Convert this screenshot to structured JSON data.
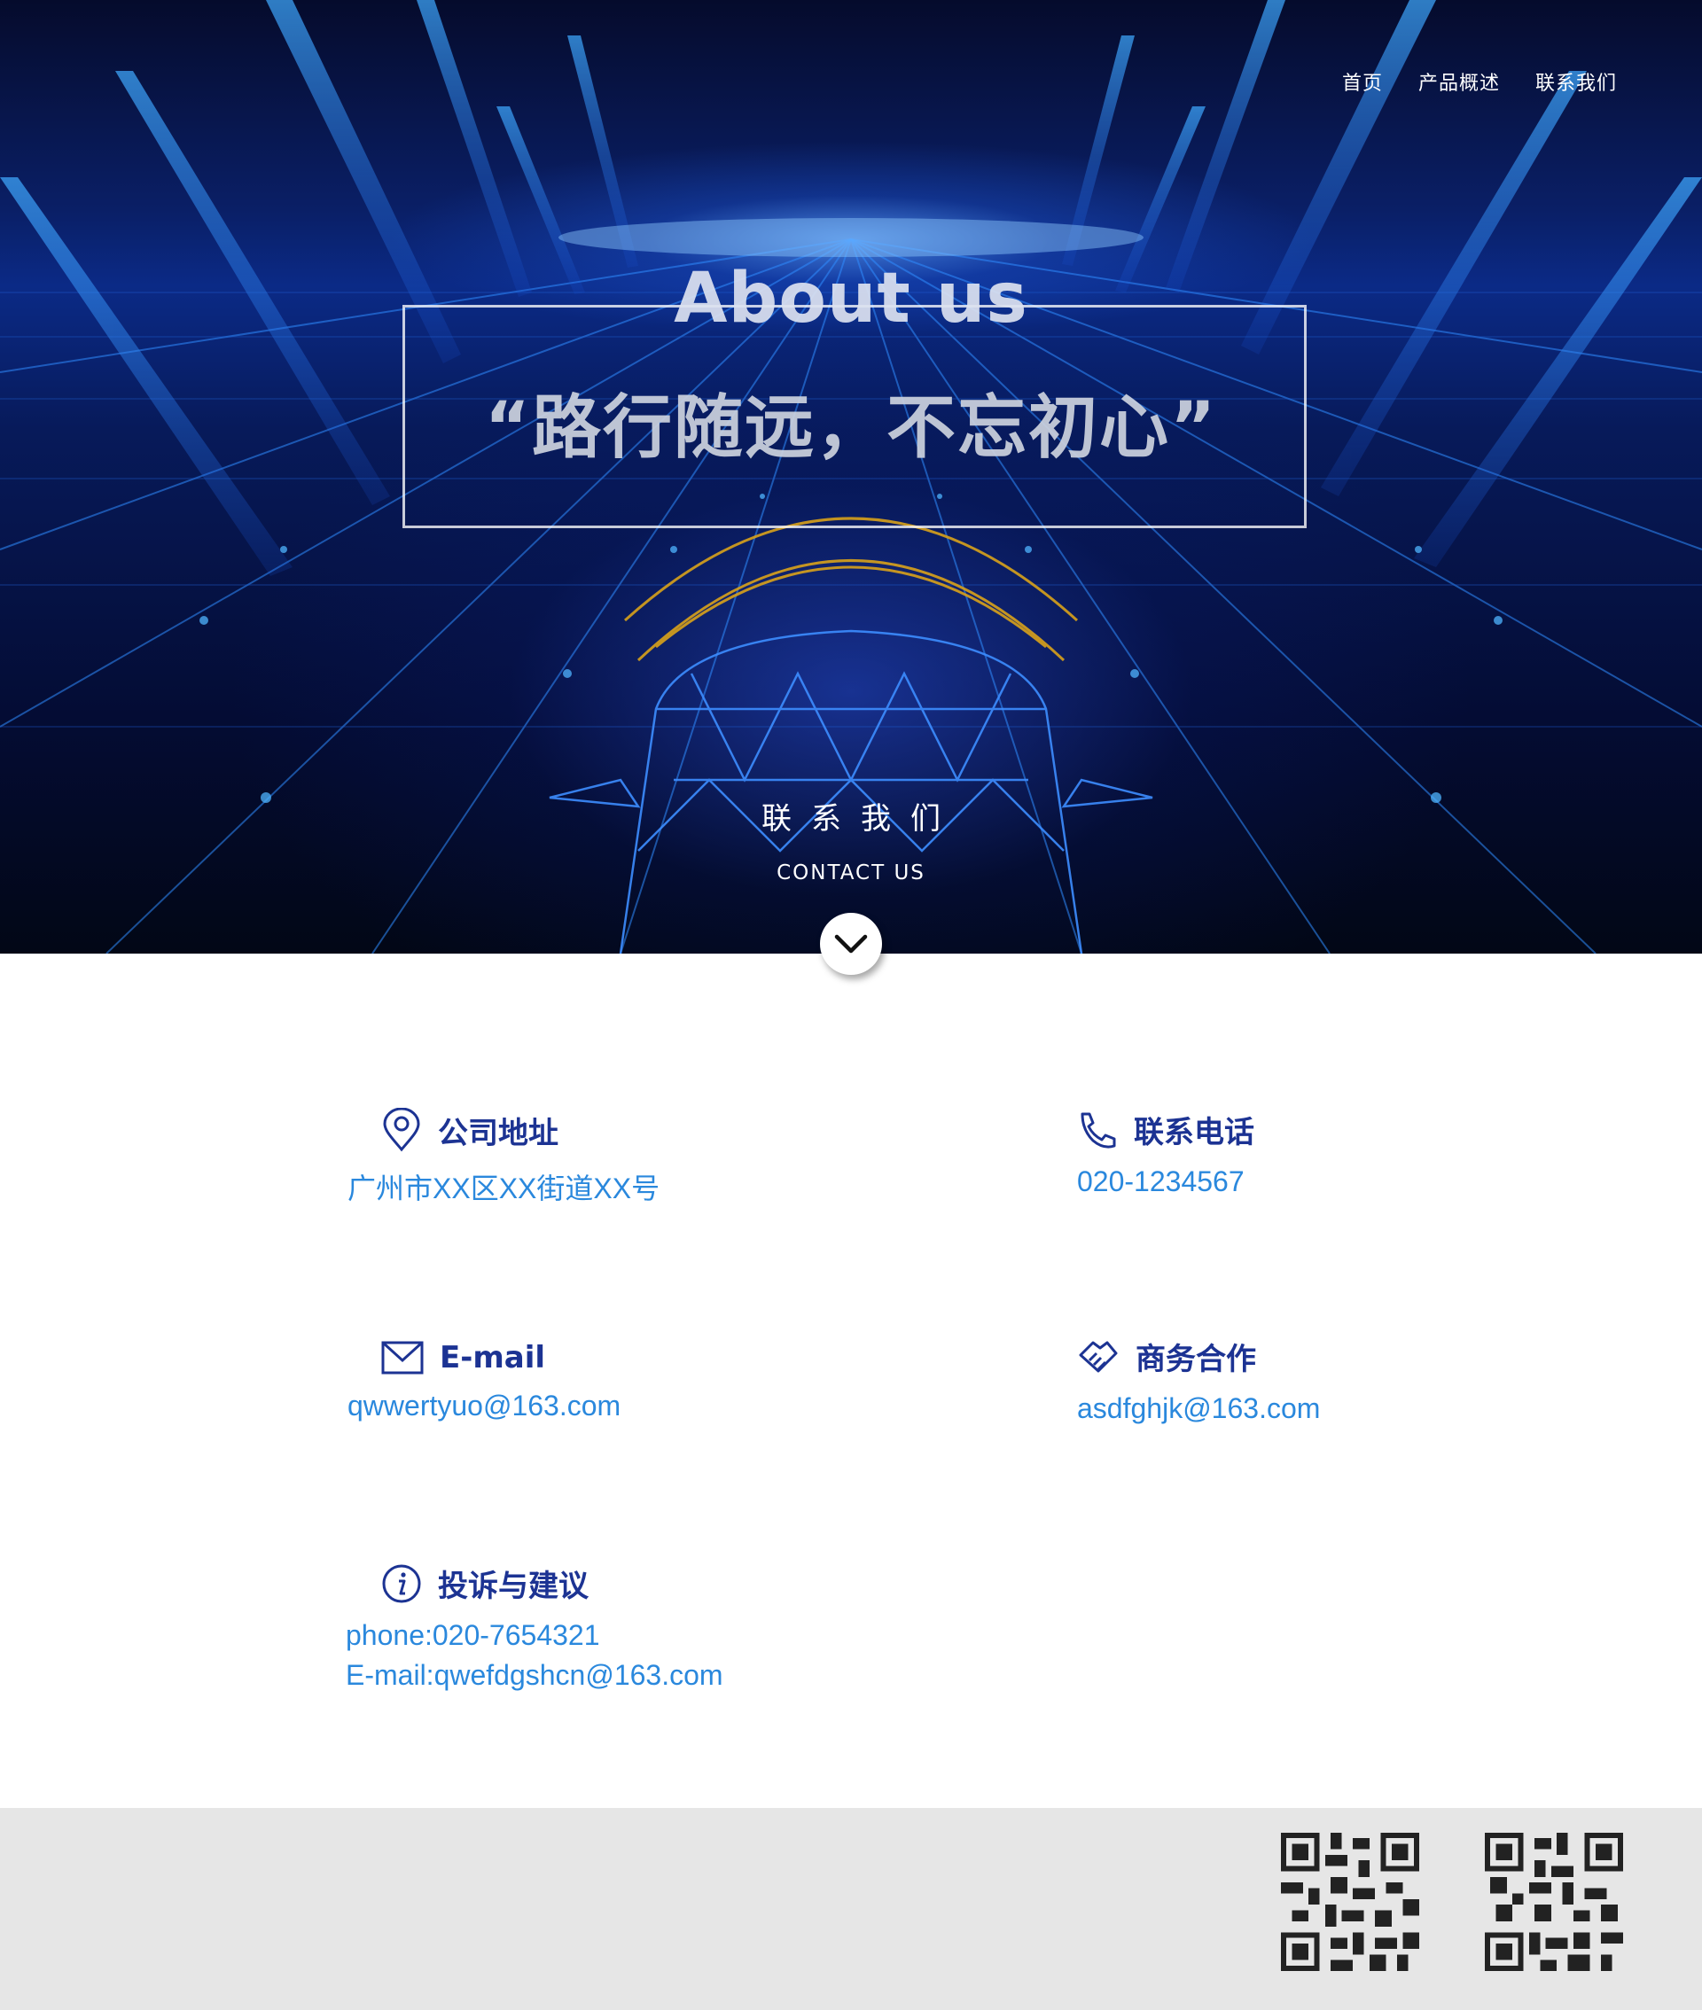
{
  "nav": {
    "items": [
      {
        "label": "首页"
      },
      {
        "label": "产品概述"
      },
      {
        "label": "联系我们"
      }
    ]
  },
  "hero": {
    "title": "About us",
    "slogan": "“路行随远，不忘初心”",
    "contact_cn": "联系我们",
    "contact_en": "CONTACT US",
    "scroll_icon": "chevron-down-icon"
  },
  "contacts": {
    "address": {
      "title": "公司地址",
      "value": "广州市XX区XX街道XX号",
      "icon": "location-pin-icon"
    },
    "phone": {
      "title": "联系电话",
      "value": "020-1234567",
      "icon": "phone-icon"
    },
    "email": {
      "title": "E-mail",
      "value": "qwwertyuo@163.com",
      "icon": "envelope-icon"
    },
    "business": {
      "title": "商务合作",
      "value": "asdfghjk@163.com",
      "icon": "handshake-icon"
    },
    "complaint": {
      "title": "投诉与建议",
      "phone": "phone:020-7654321",
      "email": "E-mail:qwefdgshcn@163.com",
      "icon": "info-icon"
    }
  },
  "footer": {
    "qr_codes": [
      "qr-code-icon",
      "qr-code-icon"
    ]
  },
  "colors": {
    "title_blue": "#1c3393",
    "value_blue": "#2a88dd",
    "footer_bg": "#e6e6e6",
    "hero_dark": "#050b2c"
  }
}
